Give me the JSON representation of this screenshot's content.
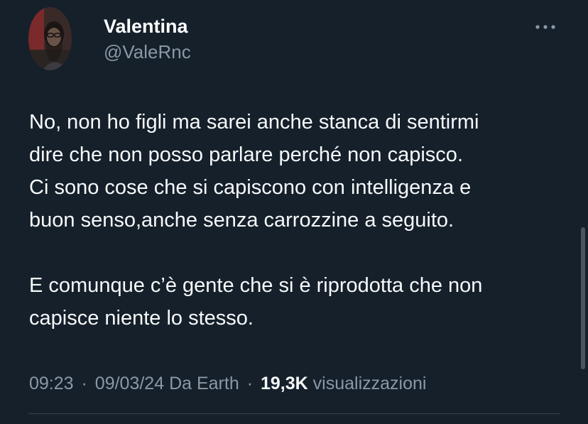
{
  "tweet": {
    "author": {
      "display_name": "Valentina",
      "handle": "@ValeRnc"
    },
    "more_icon": "ellipsis-horizontal-icon",
    "paragraphs": [
      "No, non ho figli ma sarei anche stanca di sentirmi\ndire che non posso parlare perché non capisco.\nCi sono cose che si capiscono con intelligenza e\nbuon senso,anche senza carrozzine a seguito.",
      "E comunque c’è gente che si è riprodotta che non\ncapisce niente lo stesso."
    ],
    "meta": {
      "time": "09:23",
      "date": "09/03/24",
      "source": "Da Earth",
      "views_count": "19,3K",
      "views_label": "visualizzazioni",
      "separator": "·"
    }
  },
  "colors": {
    "background": "#15202b",
    "text_primary": "#f7f9f9",
    "text_secondary": "#8b98a5",
    "divider": "#38444d"
  }
}
